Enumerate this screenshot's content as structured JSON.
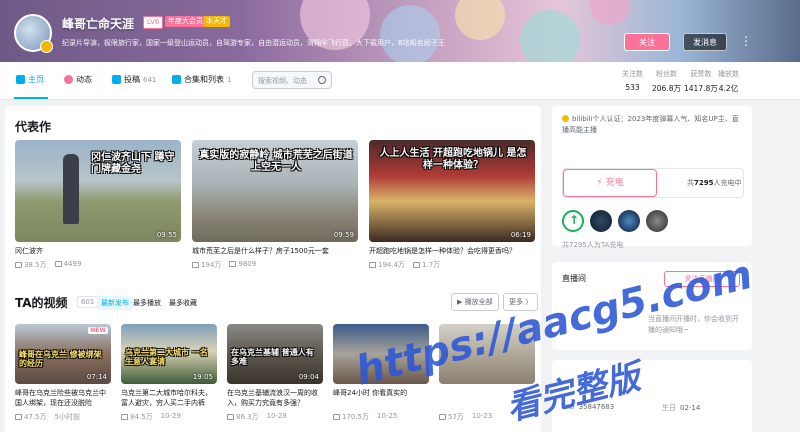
{
  "header": {
    "username": "峰哥亡命天涯",
    "level": "LV6",
    "vip_badge": "年度大会员",
    "extra_badge": "本天才",
    "bio": "纪录片导演，极限旅行家，国家一级登山运动员，自驾游专家，自由潜运动员，滑翔伞飞行员，大下载用户，B站知名段子王",
    "follow_label": "关注",
    "message_label": "发消息",
    "more_label": "⋮"
  },
  "nav": {
    "tabs": [
      {
        "label": "主页",
        "count": ""
      },
      {
        "label": "动态",
        "count": ""
      },
      {
        "label": "投稿",
        "count": "641"
      },
      {
        "label": "合集和列表",
        "count": "1"
      }
    ],
    "search_placeholder": "搜索视频、动态",
    "stats": [
      {
        "label": "关注数",
        "value": "533"
      },
      {
        "label": "粉丝数",
        "value": "206.8万"
      },
      {
        "label": "获赞数",
        "value": "1417.8万"
      },
      {
        "label": "播放数",
        "value": "4.2亿"
      }
    ]
  },
  "masterpiece": {
    "title": "代表作",
    "videos": [
      {
        "caption": "冈仁波齐山下 蹲守门牌藏金尧",
        "title": "冈仁波齐",
        "duration": "09:55",
        "plays": "38.5万",
        "danmaku": "4499"
      },
      {
        "caption": "真实版的寂静岭 城市荒芜之后街道上空无一人",
        "title": "城市荒芜之后是什么样子？房子1500元一套",
        "duration": "09:59",
        "plays": "194万",
        "danmaku": "9809"
      },
      {
        "caption": "人上人生活 开超跑吃地锅儿 是怎样一种体验？",
        "title": "开超跑吃地锅是怎样一种体验？会吃得更香吗？",
        "duration": "06:19",
        "plays": "194.4万",
        "danmaku": "1.7万"
      }
    ]
  },
  "videos": {
    "title": "TA的视频",
    "count": "601",
    "sorts": [
      "最新发布",
      "最多播放",
      "最多收藏"
    ],
    "play_all": "播放全部",
    "more": "更多 〉",
    "items": [
      {
        "caption": "峰哥在乌克兰 慘被绑架的经历",
        "badge": "NEW",
        "title": "峰哥在乌克兰险些被乌克兰中国人绑架，现在还没脱险",
        "duration": "07:14",
        "plays": "47.5万",
        "time": "5小时前"
      },
      {
        "caption": "乌克兰第二大城市 一名生意人宴请",
        "badge": "",
        "title": "乌克兰第二大城市哈尔科夫，富人避灾，穷人买二手内裤",
        "duration": "19:05",
        "plays": "84.5万",
        "time": "10-29"
      },
      {
        "caption": "在乌克兰基辅 普通人有多难",
        "badge": "",
        "title": "在乌克兰基辅流浪汉一周的收入，购买力究竟有多强？",
        "duration": "09:04",
        "plays": "86.3万",
        "time": "10-28"
      },
      {
        "caption": "",
        "badge": "",
        "title": "峰哥24小时 你看真实的",
        "duration": "",
        "plays": "170.5万",
        "time": "10-25"
      },
      {
        "caption": "",
        "badge": "",
        "title": "",
        "duration": "",
        "plays": "57万",
        "time": "10-23"
      }
    ]
  },
  "sidebar": {
    "certification": "bilibili个人认证：2023年度弹幕人气、知名UP主、直播高能主播",
    "charge_label": "充电",
    "charge_count_prefix": "共",
    "charge_count": "7295",
    "charge_count_suffix": "人充电中",
    "charge_note": "共7295人为TA充电",
    "live_title": "直播间",
    "live_follow": "关注直播间",
    "live_note_1": "当直播间开播时，你会收到开播的通知哦~",
    "uid_label": "UID",
    "uid": "35847683",
    "birthday_label": "生日",
    "birthday": "02-14"
  },
  "watermark": {
    "line1": "https://aacg5.com",
    "line2": "看完整版"
  },
  "colors": {
    "accent": "#00aeec",
    "pink": "#fb7299"
  }
}
